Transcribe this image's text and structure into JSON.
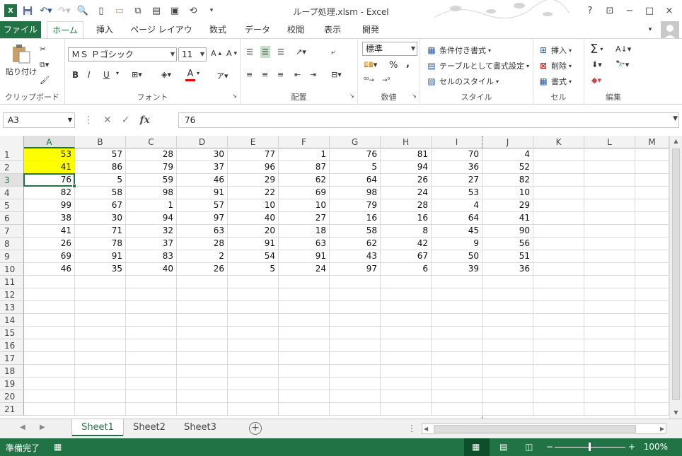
{
  "window": {
    "title": "ループ処理.xlsm - Excel",
    "help": "?",
    "controls": [
      "−",
      "□",
      "×"
    ]
  },
  "qat": [
    "save-icon",
    "undo-icon",
    "redo-icon",
    "print-preview-icon",
    "new-icon",
    "open-icon",
    "icon-a",
    "icon-b",
    "icon-c",
    "icon-d"
  ],
  "tabs": [
    "ファイル",
    "ホーム",
    "挿入",
    "ページ レイアウト",
    "数式",
    "データ",
    "校閲",
    "表示",
    "開発"
  ],
  "ribbon": {
    "clipboard": {
      "paste": "貼り付け",
      "label": "クリップボード"
    },
    "font": {
      "name": "ＭＳ Ｐゴシック",
      "size": "11",
      "bold": "B",
      "italic": "I",
      "underline": "U",
      "fontcolor": "A",
      "label": "フォント"
    },
    "alignment": {
      "label": "配置"
    },
    "number": {
      "format": "標準",
      "percent": "%",
      "comma": ",",
      "label": "数値"
    },
    "styles": {
      "conditional": "条件付き書式",
      "table": "テーブルとして書式設定",
      "cellstyle": "セルのスタイル",
      "label": "スタイル"
    },
    "cells": {
      "insert": "挿入",
      "delete": "削除",
      "format": "書式",
      "label": "セル"
    },
    "editing": {
      "sum": "Σ",
      "label": "編集"
    }
  },
  "formulaBar": {
    "nameBox": "A3",
    "fx": "fx",
    "value": "76"
  },
  "columns": [
    "A",
    "B",
    "C",
    "D",
    "E",
    "F",
    "G",
    "H",
    "I",
    "J",
    "K",
    "L",
    "M"
  ],
  "rows": [
    "1",
    "2",
    "3",
    "4",
    "5",
    "6",
    "7",
    "8",
    "9",
    "10",
    "11",
    "12",
    "13",
    "14",
    "15",
    "16",
    "17",
    "18",
    "19",
    "20",
    "21"
  ],
  "cells": [
    [
      53,
      57,
      28,
      30,
      77,
      1,
      76,
      81,
      70,
      4
    ],
    [
      41,
      86,
      79,
      37,
      96,
      87,
      5,
      94,
      36,
      52
    ],
    [
      76,
      5,
      59,
      46,
      29,
      62,
      64,
      26,
      27,
      82
    ],
    [
      82,
      58,
      98,
      91,
      22,
      69,
      98,
      24,
      53,
      10
    ],
    [
      99,
      67,
      1,
      57,
      10,
      10,
      79,
      28,
      4,
      29
    ],
    [
      38,
      30,
      94,
      97,
      40,
      27,
      16,
      16,
      64,
      41
    ],
    [
      41,
      71,
      32,
      63,
      20,
      18,
      58,
      8,
      45,
      90
    ],
    [
      26,
      78,
      37,
      28,
      91,
      63,
      62,
      42,
      9,
      56
    ],
    [
      69,
      91,
      83,
      2,
      54,
      91,
      43,
      67,
      50,
      51
    ],
    [
      46,
      35,
      40,
      26,
      5,
      24,
      97,
      6,
      39,
      36
    ]
  ],
  "highlightColor": "#ffff00",
  "sheets": [
    "Sheet1",
    "Sheet2",
    "Sheet3"
  ],
  "status": {
    "text": "準備完了",
    "zoom": "100%",
    "zoomMinus": "−",
    "zoomPlus": "+"
  },
  "colors": {
    "accent": "#217346"
  }
}
